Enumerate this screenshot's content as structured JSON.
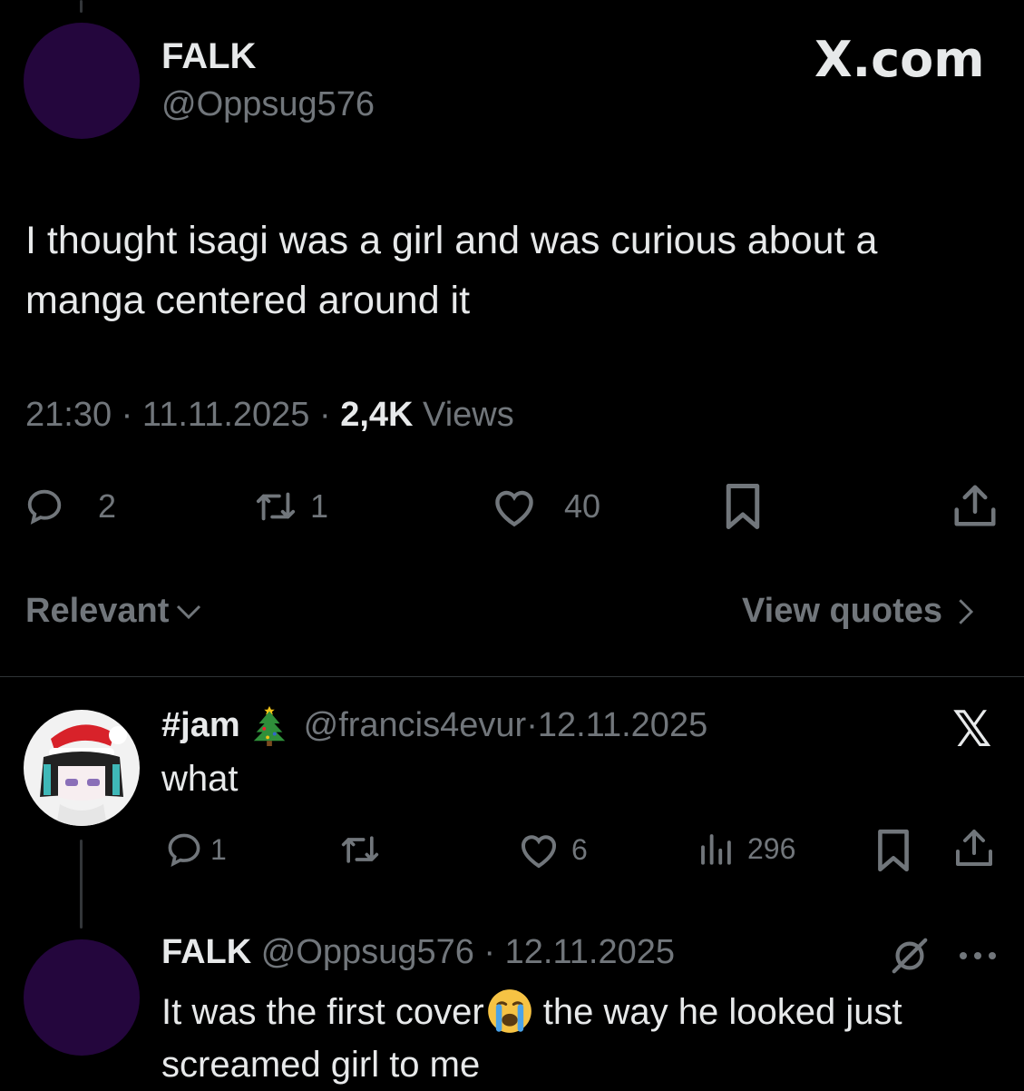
{
  "main_tweet": {
    "display_name": "FALK",
    "handle": "@Oppsug576",
    "brand": "X.com",
    "text_line1": "I thought isagi was a girl and was curious about a",
    "text_line2": "manga centered around it",
    "time": "21:30",
    "date": "11.11.2025",
    "views_count": "2,4K",
    "views_label": "Views",
    "replies": "2",
    "reposts": "1",
    "likes": "40",
    "avatar_color": "#24063d"
  },
  "reply_controls": {
    "sort_label": "Relevant",
    "quotes_label": "View quotes"
  },
  "reply_1": {
    "display_name": "#jam",
    "handle": "@francis4evur",
    "date": "12.11.2025",
    "text": "what",
    "replies": "1",
    "likes": "6",
    "views": "296"
  },
  "reply_2": {
    "display_name": "FALK",
    "handle": "@Oppsug576",
    "date": "12.11.2025",
    "text_part1": "It was the first cover",
    "text_part2": " the way he looked just",
    "text_line2": "screamed girl to me",
    "avatar_color": "#24063d"
  },
  "icons": [
    "reply-icon",
    "repost-icon",
    "like-icon",
    "bookmark-icon",
    "share-icon",
    "views-icon",
    "chevron-down-icon",
    "chevron-right-icon",
    "x-logo-icon",
    "grok-icon",
    "more-icon",
    "christmas-tree-icon",
    "crying-face-icon"
  ]
}
